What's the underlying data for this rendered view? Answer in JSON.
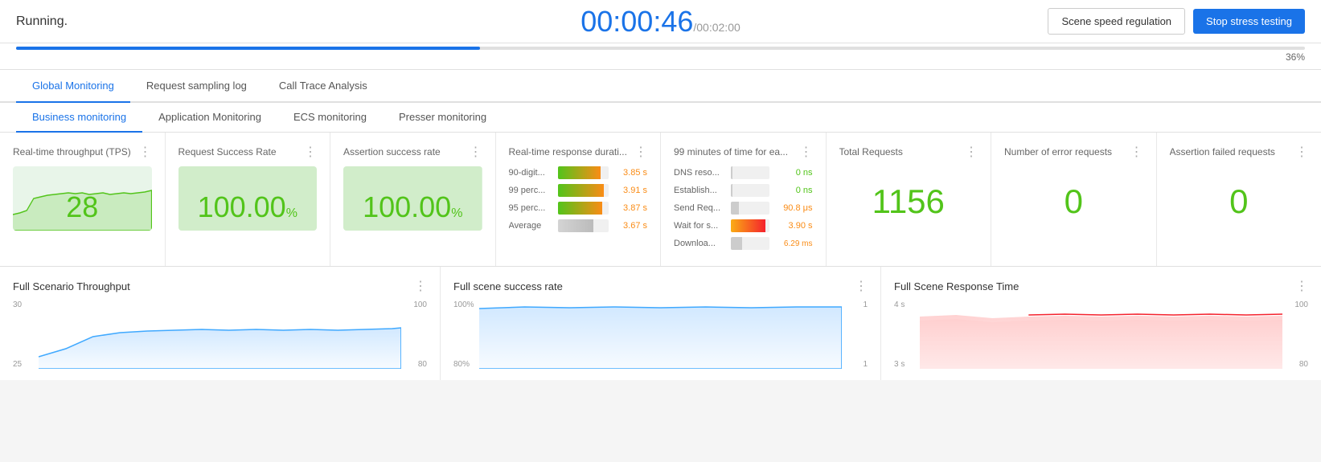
{
  "header": {
    "status": "Running.",
    "timer": "00:00:46",
    "timer_separator": "/",
    "timer_total": "00:02:00",
    "btn_scene": "Scene speed regulation",
    "btn_stop": "Stop stress testing"
  },
  "progress": {
    "percent": 36,
    "label": "36%"
  },
  "tabs_primary": [
    {
      "label": "Global Monitoring",
      "active": true
    },
    {
      "label": "Request sampling log",
      "active": false
    },
    {
      "label": "Call Trace Analysis",
      "active": false
    }
  ],
  "tabs_secondary": [
    {
      "label": "Business monitoring",
      "active": true
    },
    {
      "label": "Application Monitoring",
      "active": false
    },
    {
      "label": "ECS monitoring",
      "active": false
    },
    {
      "label": "Presser monitoring",
      "active": false
    }
  ],
  "metrics": {
    "tps": {
      "title": "Real-time throughput (TPS)",
      "value": "28"
    },
    "success_rate": {
      "title": "Request Success Rate",
      "value": "100.00",
      "unit": "%"
    },
    "assertion_rate": {
      "title": "Assertion success rate",
      "value": "100.00",
      "unit": "%"
    },
    "rt_response": {
      "title": "Real-time response durati...",
      "items": [
        {
          "label": "90-digit...",
          "value": "3.85 s",
          "pct": 85
        },
        {
          "label": "99 perc...",
          "value": "3.91 s",
          "pct": 90
        },
        {
          "label": "95 perc...",
          "value": "3.87 s",
          "pct": 88
        },
        {
          "label": "Average",
          "value": "3.67 s",
          "pct": 70
        }
      ]
    },
    "time_99": {
      "title": "99 minutes of time for ea...",
      "items": [
        {
          "label": "DNS reso...",
          "value": "0 ns",
          "pct": 5,
          "color_class": "green"
        },
        {
          "label": "Establish...",
          "value": "0 ns",
          "pct": 5,
          "color_class": "green"
        },
        {
          "label": "Send Req...",
          "value": "90.8 μs",
          "pct": 20,
          "color_class": "orange"
        },
        {
          "label": "Wait for s...",
          "value": "3.90 s",
          "pct": 90,
          "color_class": "red"
        },
        {
          "label": "Downloa...",
          "value": "6.29 ms",
          "pct": 30,
          "color_class": "orange"
        }
      ]
    },
    "total_requests": {
      "title": "Total Requests",
      "value": "1156"
    },
    "error_requests": {
      "title": "Number of error requests",
      "value": "0"
    },
    "assertion_failed": {
      "title": "Assertion failed requests",
      "value": "0"
    }
  },
  "bottom_charts": {
    "throughput": {
      "title": "Full Scenario Throughput",
      "y_left": [
        "30",
        "25"
      ],
      "y_right": [
        "100",
        "80"
      ]
    },
    "success_rate": {
      "title": "Full scene success rate",
      "y_left": [
        "100%",
        "80%"
      ],
      "y_right": [
        "1",
        "1"
      ]
    },
    "response_time": {
      "title": "Full Scene Response Time",
      "y_left": [
        "4 s",
        "3 s"
      ],
      "y_right": [
        "100",
        "80"
      ]
    }
  }
}
